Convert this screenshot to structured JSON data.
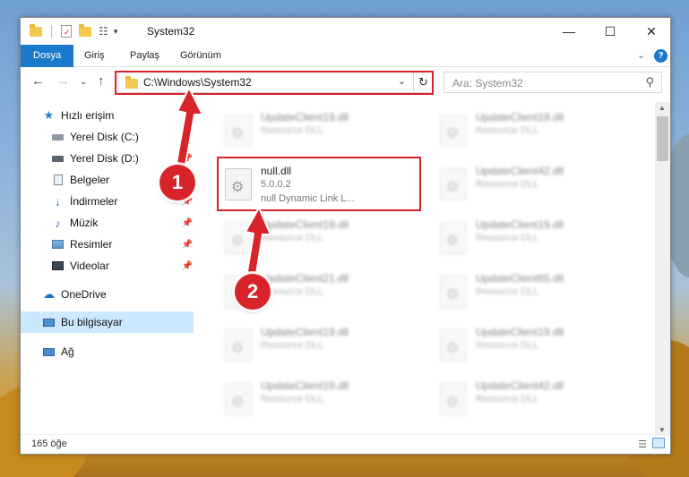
{
  "window": {
    "title": "System32"
  },
  "ribbon": {
    "tabs": [
      {
        "label": "Dosya"
      },
      {
        "label": "Giriş"
      },
      {
        "label": "Paylaş"
      },
      {
        "label": "Görünüm"
      }
    ]
  },
  "address": {
    "path": "C:\\Windows\\System32",
    "search_placeholder": "Ara: System32"
  },
  "sidebar": {
    "items": [
      {
        "label": "Hızlı erişim",
        "icon": "star-icon"
      },
      {
        "label": "Yerel Disk (C:)",
        "icon": "drive-icon"
      },
      {
        "label": "Yerel Disk (D:)",
        "icon": "drive-icon"
      },
      {
        "label": "Belgeler",
        "icon": "documents-icon"
      },
      {
        "label": "İndirmeler",
        "icon": "download-icon"
      },
      {
        "label": "Müzik",
        "icon": "music-icon"
      },
      {
        "label": "Resimler",
        "icon": "pictures-icon"
      },
      {
        "label": "Videolar",
        "icon": "video-icon"
      },
      {
        "label": "OneDrive",
        "icon": "cloud-icon"
      },
      {
        "label": "Bu bilgisayar",
        "icon": "computer-icon"
      },
      {
        "label": "Ağ",
        "icon": "network-icon"
      }
    ]
  },
  "files": {
    "highlighted": {
      "name": "null.dll",
      "version": "5.0.0.2",
      "description": "null Dynamic Link L..."
    },
    "left_column": [
      {
        "name": "UpdateClient19.dll",
        "type": "Resource DLL"
      },
      {
        "name": "UpdateClient19.dll",
        "type": "Resource DLL"
      },
      {
        "name": "UpdateClient21.dll",
        "type": "Resource DLL"
      },
      {
        "name": "UpdateClient19.dll",
        "type": "Resource DLL"
      },
      {
        "name": "UpdateClient19.dll",
        "type": "Resource DLL"
      }
    ],
    "right_column": [
      {
        "name": "UpdateClient19.dll",
        "type": "Resource DLL"
      },
      {
        "name": "UpdateClient42.dll",
        "type": "Resource DLL"
      },
      {
        "name": "UpdateClient19.dll",
        "type": "Resource DLL"
      },
      {
        "name": "UpdateClient65.dll",
        "type": "Resource DLL"
      },
      {
        "name": "UpdateClient19.dll",
        "type": "Resource DLL"
      },
      {
        "name": "UpdateClient42.dll",
        "type": "Resource DLL"
      }
    ]
  },
  "status": {
    "item_count": "165 öğe"
  },
  "callouts": {
    "step1": "1",
    "step2": "2"
  },
  "colors": {
    "accent": "#1979ca",
    "highlight_red": "#d8232a",
    "selection": "#cce8ff"
  }
}
